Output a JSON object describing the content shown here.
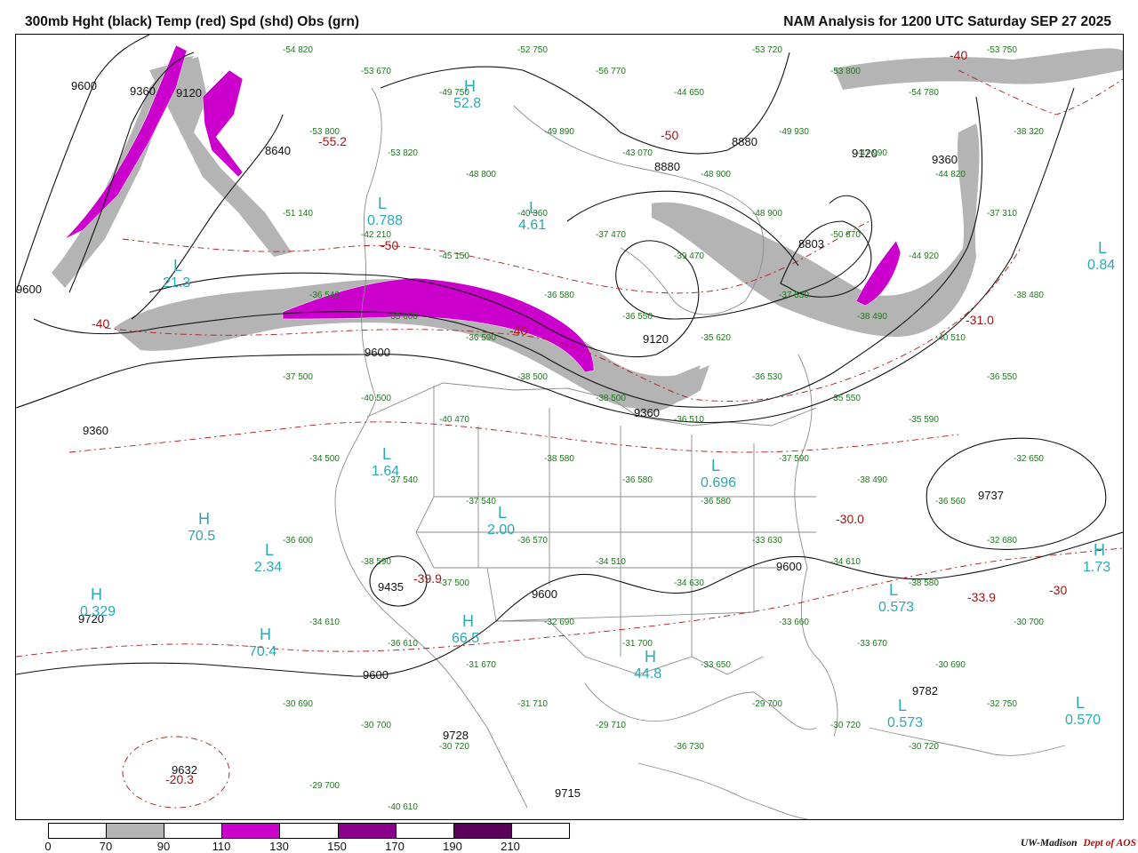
{
  "header": {
    "title_left": "300mb Hght (black) Temp (red) Spd (shd) Obs (grn)",
    "title_right": "NAM Analysis for 1200 UTC Saturday  SEP 27 2025"
  },
  "colors": {
    "height_contour": "#111111",
    "temp_contour": "#b01818",
    "speed_70": "#b4b4b4",
    "speed_110": "#cc00cc",
    "speed_150": "#8a008a",
    "speed_190": "#5a005a",
    "obs": "#1a7a1a",
    "centers": "#2aa8b4",
    "borders": "#8c8c8c"
  },
  "legend": {
    "ticks": [
      "0",
      "70",
      "90",
      "110",
      "130",
      "150",
      "170",
      "190",
      "210"
    ],
    "segment_colors": [
      "#ffffff",
      "#b4b4b4",
      "#ffffff",
      "#cc00cc",
      "#ffffff",
      "#8a008a",
      "#ffffff",
      "#5a005a",
      "#ffffff"
    ]
  },
  "credit": {
    "text": "UW-Madison",
    "dept": "Dept of AOS"
  },
  "map": {
    "height_labels": [
      "9600",
      "9360",
      "9120",
      "8880",
      "8880",
      "9120",
      "9360",
      "9600",
      "9360",
      "9600",
      "9120",
      "9360",
      "9600",
      "9600",
      "9600",
      "9737",
      "9435",
      "9720",
      "9715",
      "9782",
      "9632",
      "9728",
      "8803",
      "8640"
    ],
    "centers": [
      {
        "sym": "H",
        "val": "52.8"
      },
      {
        "sym": "L",
        "val": "0.788"
      },
      {
        "sym": "L",
        "val": "4.61"
      },
      {
        "sym": "L",
        "val": "21.3"
      },
      {
        "sym": "L",
        "val": "1.64"
      },
      {
        "sym": "L",
        "val": "0.696"
      },
      {
        "sym": "L",
        "val": "2.00"
      },
      {
        "sym": "H",
        "val": "70.5"
      },
      {
        "sym": "L",
        "val": "2.34"
      },
      {
        "sym": "H",
        "val": "70.4"
      },
      {
        "sym": "H",
        "val": "0.329"
      },
      {
        "sym": "L",
        "val": "0.573"
      },
      {
        "sym": "H",
        "val": "44.8"
      },
      {
        "sym": "L",
        "val": "0.573"
      },
      {
        "sym": "L",
        "val": "0.570"
      },
      {
        "sym": "L",
        "val": "0.84"
      },
      {
        "sym": "H",
        "val": "66.5"
      },
      {
        "sym": "H",
        "val": "1.73"
      }
    ],
    "temp_labels": [
      "-50",
      "-50",
      "-40",
      "-40",
      "-40",
      "-31.0",
      "-30.0",
      "-33.9",
      "-30",
      "-39.9",
      "-20.3",
      "-55.2"
    ],
    "obs": [
      "-54 820",
      "-53 670",
      "-49 750",
      "-52 750",
      "-56 770",
      "-44 650",
      "-53 720",
      "-53 800",
      "-54 780",
      "-53 750",
      "-53 800",
      "-53 820",
      "-48 800",
      "-49 890",
      "-43 070",
      "-48 900",
      "-49 930",
      "-47 990",
      "-44 820",
      "-38 320",
      "-51 140",
      "-42 210",
      "-45 150",
      "-40 360",
      "-37 470",
      "-39 470",
      "-48 900",
      "-50 870",
      "-44 920",
      "-37 310",
      "-36 540",
      "-35 600",
      "-36 590",
      "-36 580",
      "-36 550",
      "-35 620",
      "-37 530",
      "-38 490",
      "-40 510",
      "-38 480",
      "-37 500",
      "-40 500",
      "-40 470",
      "-38 500",
      "-38 500",
      "-36 510",
      "-36 530",
      "-35 550",
      "-35 590",
      "-36 550",
      "-34 500",
      "-37 540",
      "-37 540",
      "-38 580",
      "-36 580",
      "-36 580",
      "-37 590",
      "-38 490",
      "-36 560",
      "-32 650",
      "-36 600",
      "-38 590",
      "-37 500",
      "-36 570",
      "-34 510",
      "-34 630",
      "-33 630",
      "-34 610",
      "-38 580",
      "-32 680",
      "-34 610",
      "-36 610",
      "-31 670",
      "-32 690",
      "-31 700",
      "-33 650",
      "-33 660",
      "-33 670",
      "-30 690",
      "-30 700",
      "-30 690",
      "-30 700",
      "-30 720",
      "-31 710",
      "-29 710",
      "-36 730",
      "-29 700",
      "-30 720",
      "-30 720",
      "-32 750",
      "-29 700",
      "-40 610"
    ]
  }
}
